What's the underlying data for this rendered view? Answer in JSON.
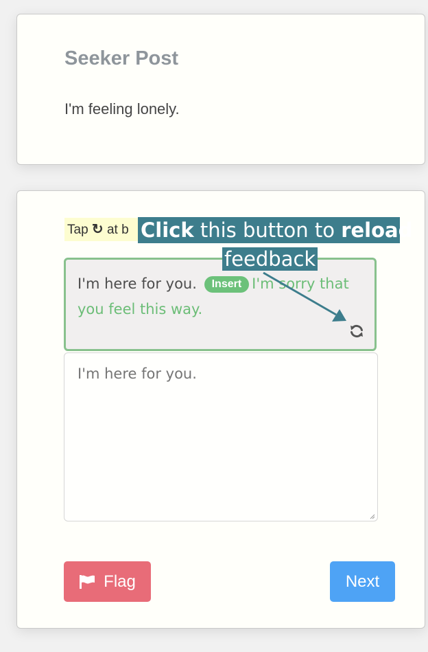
{
  "seeker": {
    "title": "Seeker Post",
    "text": "I'm feeling lonely."
  },
  "hint": {
    "prefix": "Tap",
    "icon": "reload-icon",
    "suffix": "at b"
  },
  "feedback": {
    "original": "I'm here for you.",
    "badge": "Insert",
    "suggestion": "I'm sorry that you feel this way.",
    "reload_icon": "reload-icon"
  },
  "response": {
    "value": "I'm here for you."
  },
  "buttons": {
    "flag_label": "Flag",
    "flag_icon": "flag-icon",
    "next_label": "Next"
  },
  "tutorial": {
    "word1": "Click",
    "text1": " this button to ",
    "word2": "reload",
    "text2": "feedback",
    "color": "#3d7d8c"
  },
  "colors": {
    "insert_badge": "#6cc17a",
    "suggestion_text": "#6cbd77",
    "feedback_border": "#88c18d",
    "flag_button": "#e86c78",
    "next_button": "#4ea3f5",
    "hint_highlight": "#fdfdd0"
  }
}
